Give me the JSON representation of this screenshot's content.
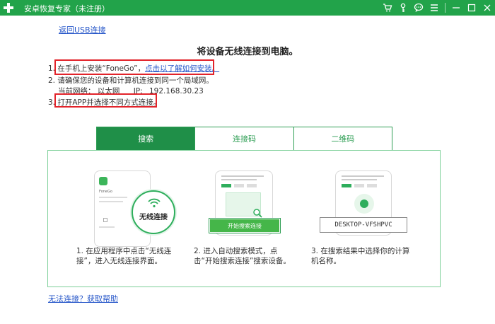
{
  "window": {
    "title": "安卓恢复专家（未注册）"
  },
  "header_icons": [
    "cart-icon",
    "key-icon",
    "chat-icon",
    "menu-icon",
    "minimize-icon",
    "maximize-icon",
    "close-icon"
  ],
  "back_link": "返回USB连接",
  "heading": "将设备无线连接到电脑。",
  "steps": {
    "s1_prefix": "1. 在手机上安装“FoneGo”，",
    "s1_link": "点击以了解如何安装。",
    "s2": "2. 请确保您的设备和计算机连接到同一个局域网。",
    "s2_network_label": "当前网络：",
    "s2_network_value": "以太网",
    "s2_ip_label": "IP:",
    "s2_ip_value": "192.168.30.23",
    "s3": "3. 打开APP并选择不同方式连接。"
  },
  "tabs": [
    {
      "label": "搜索",
      "active": true
    },
    {
      "label": "连接码",
      "active": false
    },
    {
      "label": "二维码",
      "active": false
    }
  ],
  "cards": [
    {
      "badge": "无线连接",
      "app_name": "FoneGo",
      "caption": "1. 在应用程序中点击“无线连接”，进入无线连接界面。",
      "caption_line1": "1. 在应用程序中点击“无线连",
      "caption_line2": "接”，进入无线连接界面。"
    },
    {
      "button": "开始搜索连接",
      "caption_line1": "2. 进入自动搜索模式，点",
      "caption_line2": "击“开始搜索连接”搜索设备。"
    },
    {
      "device_name": "DESKTOP-VFSHPVC",
      "caption_line1": "3. 在搜索结果中选择你的计算",
      "caption_line2": "机名称。"
    }
  ],
  "help_link": "无法连接？获取帮助",
  "colors": {
    "accent": "#22a34a",
    "tab_active": "#1f8f48",
    "link": "#2757c9",
    "highlight": "#e2232a"
  }
}
